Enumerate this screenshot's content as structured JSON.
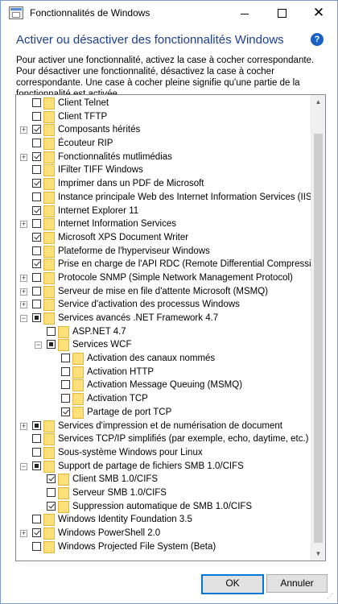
{
  "window": {
    "title": "Fonctionnalités de Windows"
  },
  "heading": "Activer ou désactiver des fonctionnalités Windows",
  "description": "Pour activer une fonctionnalité, activez la case à cocher correspondante. Pour désactiver une fonctionnalité, désactivez la case à cocher correspondante. Une case à cocher pleine signifie qu'une partie de la fonctionnalité est activée.",
  "features": [
    {
      "label": "Client Telnet",
      "state": "unchecked",
      "level": 0,
      "expandable": false
    },
    {
      "label": "Client TFTP",
      "state": "unchecked",
      "level": 0,
      "expandable": false
    },
    {
      "label": "Composants hérités",
      "state": "checked",
      "level": 0,
      "expandable": true,
      "expanded": false
    },
    {
      "label": "Écouteur RIP",
      "state": "unchecked",
      "level": 0,
      "expandable": false
    },
    {
      "label": "Fonctionnalités mutlimédias",
      "state": "checked",
      "level": 0,
      "expandable": true,
      "expanded": false
    },
    {
      "label": "IFilter TIFF Windows",
      "state": "unchecked",
      "level": 0,
      "expandable": false
    },
    {
      "label": "Imprimer dans un PDF de Microsoft",
      "state": "checked",
      "level": 0,
      "expandable": false
    },
    {
      "label": "Instance principale Web des Internet Information Services (IIS)",
      "state": "unchecked",
      "level": 0,
      "expandable": false
    },
    {
      "label": "Internet Explorer 11",
      "state": "checked",
      "level": 0,
      "expandable": false
    },
    {
      "label": "Internet Information Services",
      "state": "unchecked",
      "level": 0,
      "expandable": true,
      "expanded": false
    },
    {
      "label": "Microsoft XPS Document Writer",
      "state": "checked",
      "level": 0,
      "expandable": false
    },
    {
      "label": "Plateforme de l'hyperviseur Windows",
      "state": "unchecked",
      "level": 0,
      "expandable": false
    },
    {
      "label": "Prise en charge de l'API RDC (Remote Differential Compression)",
      "state": "checked",
      "level": 0,
      "expandable": false
    },
    {
      "label": "Protocole SNMP (Simple Network Management Protocol)",
      "state": "unchecked",
      "level": 0,
      "expandable": true,
      "expanded": false
    },
    {
      "label": "Serveur de mise en file d'attente Microsoft (MSMQ)",
      "state": "unchecked",
      "level": 0,
      "expandable": true,
      "expanded": false
    },
    {
      "label": "Service d'activation des processus Windows",
      "state": "unchecked",
      "level": 0,
      "expandable": true,
      "expanded": false
    },
    {
      "label": "Services avancés .NET Framework 4.7",
      "state": "partial",
      "level": 0,
      "expandable": true,
      "expanded": true
    },
    {
      "label": "ASP.NET 4.7",
      "state": "unchecked",
      "level": 1,
      "expandable": false
    },
    {
      "label": "Services WCF",
      "state": "partial",
      "level": 1,
      "expandable": true,
      "expanded": true
    },
    {
      "label": "Activation des canaux nommés",
      "state": "unchecked",
      "level": 2,
      "expandable": false
    },
    {
      "label": "Activation HTTP",
      "state": "unchecked",
      "level": 2,
      "expandable": false
    },
    {
      "label": "Activation Message Queuing (MSMQ)",
      "state": "unchecked",
      "level": 2,
      "expandable": false
    },
    {
      "label": "Activation TCP",
      "state": "unchecked",
      "level": 2,
      "expandable": false
    },
    {
      "label": "Partage de port TCP",
      "state": "checked",
      "level": 2,
      "expandable": false
    },
    {
      "label": "Services d'impression et de numérisation de document",
      "state": "partial",
      "level": 0,
      "expandable": true,
      "expanded": false
    },
    {
      "label": "Services TCP/IP simplifiés (par exemple, echo, daytime, etc.)",
      "state": "unchecked",
      "level": 0,
      "expandable": false
    },
    {
      "label": "Sous-système Windows pour Linux",
      "state": "unchecked",
      "level": 0,
      "expandable": false
    },
    {
      "label": "Support de partage de fichiers SMB 1.0/CIFS",
      "state": "partial",
      "level": 0,
      "expandable": true,
      "expanded": true
    },
    {
      "label": "Client SMB 1.0/CIFS",
      "state": "checked",
      "level": 1,
      "expandable": false
    },
    {
      "label": "Serveur SMB 1.0/CIFS",
      "state": "unchecked",
      "level": 1,
      "expandable": false
    },
    {
      "label": "Suppression automatique de SMB 1.0/CIFS",
      "state": "checked",
      "level": 1,
      "expandable": false
    },
    {
      "label": "Windows Identity Foundation 3.5",
      "state": "unchecked",
      "level": 0,
      "expandable": false
    },
    {
      "label": "Windows PowerShell 2.0",
      "state": "checked",
      "level": 0,
      "expandable": true,
      "expanded": false
    },
    {
      "label": "Windows Projected File System (Beta)",
      "state": "unchecked",
      "level": 0,
      "expandable": false
    }
  ],
  "buttons": {
    "ok": "OK",
    "cancel": "Annuler"
  },
  "colors": {
    "heading": "#1e3f8f",
    "accent": "#0078d7",
    "folder": "#ffe07a"
  }
}
